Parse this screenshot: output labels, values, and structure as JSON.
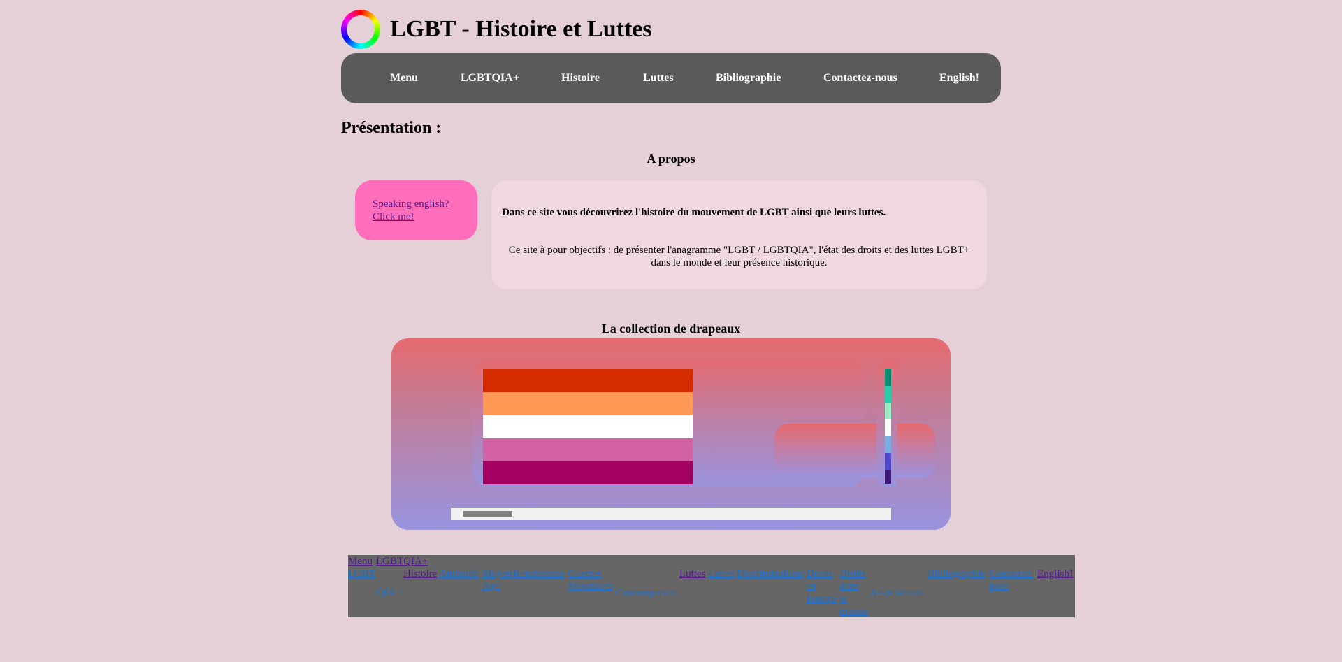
{
  "header": {
    "title": "LGBT - Histoire et Luttes",
    "logo_icon": "color-wheel-icon"
  },
  "nav": {
    "items": [
      {
        "label": "Menu"
      },
      {
        "label": "LGBTQIA+"
      },
      {
        "label": "Histoire"
      },
      {
        "label": "Luttes"
      },
      {
        "label": "Bibliographie"
      },
      {
        "label": "Contactez-nous"
      },
      {
        "label": "English!"
      }
    ]
  },
  "presentation": {
    "heading": "Présentation :",
    "about_heading": "A propos",
    "english_link": "Speaking english? Click me!",
    "intro_bold": "Dans ce site vous découvrirez l'histoire du mouvement de LGBT ainsi que leurs luttes.",
    "intro_text": "Ce site à pour objectifs : de présenter l'anagramme \"LGBT / LGBTQIA\", l'état des droits et des luttes LGBT+ dans le monde et leur présence historique."
  },
  "flags": {
    "heading": "La collection de drapeaux",
    "lesbian_flag_colors": [
      "#d52d00",
      "#ff9a56",
      "#ffffff",
      "#d362a4",
      "#a30262"
    ],
    "second_flag_colors": [
      "#078d70",
      "#26ceaa",
      "#98e8c1",
      "#ffffff",
      "#7bade2",
      "#5049cc",
      "#3d1a78"
    ]
  },
  "footer": {
    "links": [
      {
        "label": "Menu"
      },
      {
        "label": "LGBTQIA+"
      },
      {
        "label": "LGBT"
      },
      {
        "label": "Histoire"
      },
      {
        "label": "Antiquité"
      },
      {
        "label": "Moyen Age"
      },
      {
        "label": "Renaissance"
      },
      {
        "label": "Guerres Mondiales"
      },
      {
        "label": "Contemporain"
      },
      {
        "label": "Luttes"
      },
      {
        "label": "Luttes"
      },
      {
        "label": "Discriminations"
      },
      {
        "label": "Droits en Europe"
      },
      {
        "label": "Droits dans le monde"
      },
      {
        "label": "Associations"
      },
      {
        "label": "Bibliographie"
      },
      {
        "label": "Contactez-nous"
      },
      {
        "label": "English!"
      },
      {
        "label": "QIA+"
      }
    ]
  }
}
